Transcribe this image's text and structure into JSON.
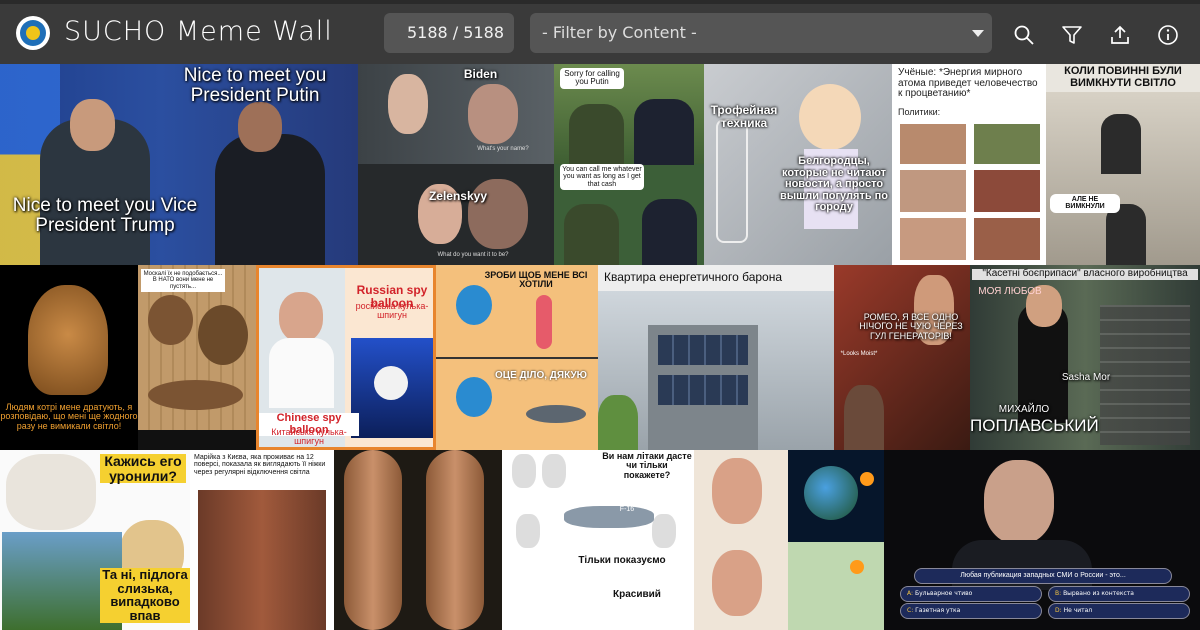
{
  "header": {
    "title": "SUCHO Meme Wall",
    "counter": "5188 / 5188",
    "filter_placeholder": "- Filter by Content -",
    "icons": [
      "search-icon",
      "filter-icon",
      "share-icon",
      "info-icon"
    ]
  },
  "memes": {
    "m1": {
      "top": "Nice to meet you President Putin",
      "bottom": "Nice to meet you Vice President Trump"
    },
    "m2": {
      "name1": "Biden",
      "name2": "Zelenskyy",
      "sub1": "What's your name?",
      "sub2": "What do you want it to be?"
    },
    "m3": {
      "b1": "Sorry for calling you Putin",
      "b2": "You can call me whatever you want as long as I get that cash"
    },
    "m4": {
      "t1": "Трофейная техника",
      "t2": "Белгородцы, которые не читают новости, а просто вышли погулять по городу"
    },
    "m5": {
      "t1": "Учёные: *Энергия мирного атома приведет человечество к процветанию*",
      "t2": "Политики:"
    },
    "m6": {
      "t1": "КОЛИ ПОВИННІ БУЛИ ВИМКНУТИ СВІТЛО",
      "t2": "АЛЕ НЕ ВИМКНУЛИ"
    },
    "m7": {
      "t1": "Людям котрі мене дратують, я розповідаю, що мені ще жодного разу не вимикали світло!"
    },
    "m8": {
      "t1": "Москалі їх не подобається... В НАТО вони мене не пустять..."
    },
    "m9": {
      "t1": "Russian spy balloon",
      "t2": "російська кулька-шпигун",
      "t3": "Chinese spy balloon",
      "t4": "Китайська кулька-шпигун"
    },
    "m10": {
      "t1": "ЗРОБИ ЩОБ МЕНЕ ВСІ ХОТІЛИ",
      "t2": "ОЦЕ ДІЛО, ДЯКУЮ"
    },
    "m11": {
      "t1": "Квартира енергетичного барона"
    },
    "m12": {
      "t1": "РОМЕО, Я ВСЕ ОДНО НІЧОГО НЕ ЧУЮ ЧЕРЕЗ ГУЛ ГЕНЕРАТОРІВ!",
      "t2": "*Looks Moist*"
    },
    "m13": {
      "t1": "\"Касетні боєприпаси\" власного виробництва",
      "t2": "МОЯ ЛЮБОВ",
      "t3": "Sasha Mor",
      "t4": "МИХАЙЛО",
      "t5": "ПОПЛАВСЬКИЙ"
    },
    "m14": {
      "t1": "Кажись его уронили?",
      "t2": "Та ні, підлога слизька, випадково впав"
    },
    "m15": {
      "t1": "Марійка з Києва, яка проживає на 12 поверсі, показала як виглядають її ніжки через регулярні відключення світла"
    },
    "m17": {
      "t1": "Ви нам літаки дасте чи тільки покажете?",
      "t2": "F-16",
      "t3": "Тільки показуємо",
      "t4": "Красивий"
    },
    "m19": {
      "t1": "Любая публикация западных СМИ о России - это...",
      "a": "A:",
      "a_t": "Бульварное чтиво",
      "b": "B:",
      "b_t": "Вырвано из контекста",
      "c": "C:",
      "c_t": "Газетная утка",
      "d": "D:",
      "d_t": "Не читал"
    }
  },
  "colors": {
    "header_bg": "#3a3a3a",
    "field_bg": "#555555",
    "text": "#ffffff"
  }
}
